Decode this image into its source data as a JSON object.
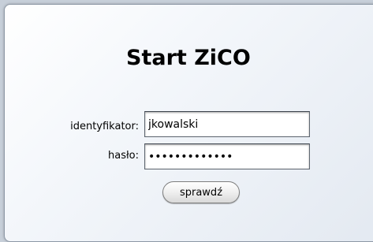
{
  "login_form": {
    "title": "Start ZiCO",
    "username_label": "identyfikator:",
    "username_value": "jkowalski",
    "password_label": "hasło:",
    "password_value": "•••••••••••••",
    "submit_label": "sprawdź"
  }
}
